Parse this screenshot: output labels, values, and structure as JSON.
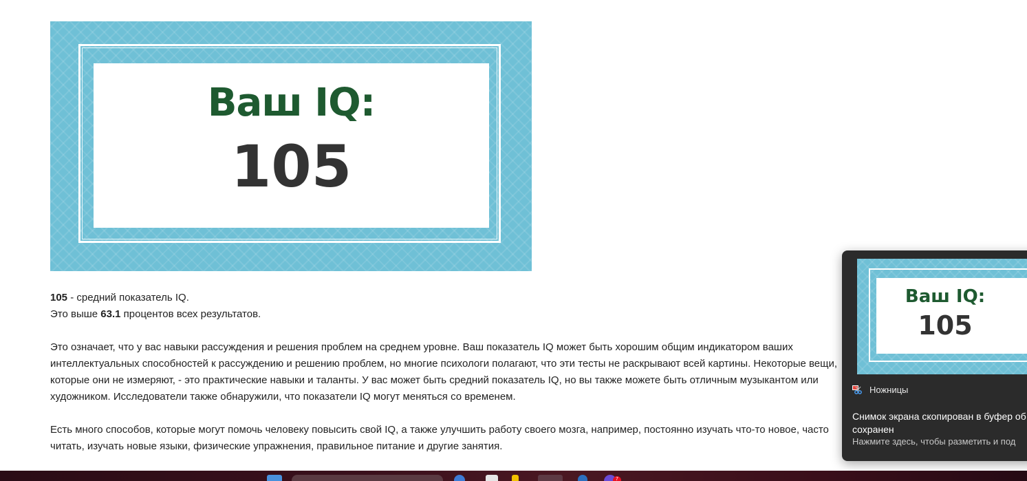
{
  "result_card": {
    "title": "Ваш IQ:",
    "score": "105",
    "colors": {
      "background": "#6fc0d6",
      "title": "#1e5a30",
      "score": "#333333"
    }
  },
  "summary": {
    "score": "105",
    "score_suffix": " - средний показатель IQ.",
    "percentile_prefix": "Это выше ",
    "percentile": "63.1",
    "percentile_suffix": " процентов всех результатов."
  },
  "paragraphs": [
    "Это означает, что у вас навыки рассуждения и решения проблем на среднем уровне. Ваш показатель IQ может быть хорошим общим индикатором ваших интеллектуальных способностей к рассуждению и решению проблем, но многие психологи полагают, что эти тесты не раскрывают всей картины. Некоторые вещи, которые они не измеряют, - это практические навыки и таланты. У вас может быть средний показатель IQ, но вы также можете быть отличным музыкантом или художником. Исследователи также обнаружили, что показатели IQ могут меняться со временем.",
    "Есть много способов, которые могут помочь человеку повысить свой IQ, а также улучшить работу своего мозга, например, постоянно изучать что-то новое, часто читать, изучать новые языки, физические упражнения, правильное питание и другие занятия."
  ],
  "notification": {
    "app_name": "Ножницы",
    "app_icon": "snipping-tool-icon",
    "thumbnail_title": "Ваш IQ:",
    "thumbnail_score": "105",
    "message": "Снимок экрана скопирован в буфер об сохранен",
    "hint": "Нажмите здесь, чтобы разметить и под",
    "colors": {
      "background": "#2b2b2b"
    }
  },
  "taskbar": {
    "badge_count": "7"
  }
}
